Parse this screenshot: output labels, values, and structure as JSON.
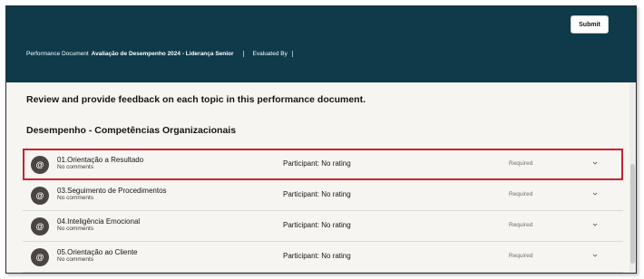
{
  "header": {
    "submit_label": "Submit",
    "doc_label": "Performance Document",
    "doc_name": "Avaliação de Desempenho 2024 - Liderança Senior",
    "evaluated_by_label": "Evaluated By"
  },
  "main": {
    "instruction": "Review and provide feedback on each topic in this performance document.",
    "section_title": "Desempenho - Competências Organizacionais",
    "topics": [
      {
        "title": "01.Orientação a Resultado",
        "comments": "No comments",
        "participant": "Participant: No rating",
        "status": "Required",
        "avatar": "@",
        "selected": true
      },
      {
        "title": "03.Seguimento de Procedimentos",
        "comments": "No comments",
        "participant": "Participant: No rating",
        "status": "Required",
        "avatar": "@"
      },
      {
        "title": "04.Inteligência Emocional",
        "comments": "No comments",
        "participant": "Participant: No rating",
        "status": "Required",
        "avatar": "@"
      },
      {
        "title": "05.Orientação ao Cliente",
        "comments": "No comments",
        "participant": "Participant: No rating",
        "status": "Required",
        "avatar": "@"
      }
    ]
  },
  "colors": {
    "header_bg": "#0e3a4a",
    "highlight": "#d0202a",
    "avatar_bg": "#4a4541"
  }
}
